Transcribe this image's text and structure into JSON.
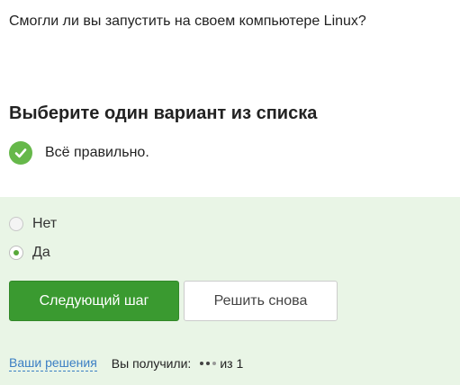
{
  "question": {
    "text": "Смогли ли вы запустить на своем компьютере Linux?"
  },
  "task": {
    "heading": "Выберите один вариант из списка"
  },
  "feedback": {
    "status_text": "Всё правильно.",
    "status_color": "#66b84a",
    "icon": "checkmark-icon"
  },
  "options": [
    {
      "label": "Нет",
      "selected": false
    },
    {
      "label": "Да",
      "selected": true
    }
  ],
  "actions": {
    "next_label": "Следующий шаг",
    "retry_label": "Решить снова"
  },
  "footer": {
    "solutions_link": "Ваши решения",
    "score_label": "Вы получили:",
    "score_suffix": "из 1"
  },
  "colors": {
    "accent": "#3a9a30",
    "panel_background": "#e9f5e6",
    "link": "#3b7fc4"
  }
}
